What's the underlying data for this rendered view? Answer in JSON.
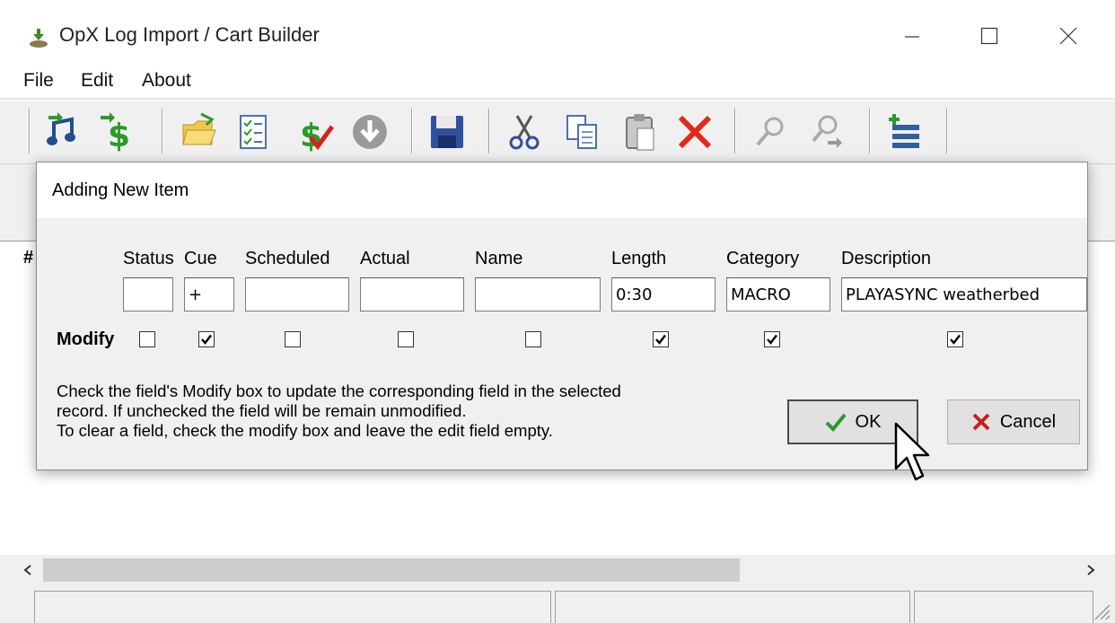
{
  "window": {
    "title": "OpX Log Import / Cart Builder"
  },
  "menu": {
    "items": [
      "File",
      "Edit",
      "About"
    ]
  },
  "toolbar": {
    "icons": [
      "import-music-icon",
      "import-cash-icon",
      "open-folder-icon",
      "checklist-icon",
      "cash-check-icon",
      "download-icon",
      "save-icon",
      "cut-icon",
      "copy-icon",
      "paste-icon",
      "delete-icon",
      "find-icon",
      "find-next-icon",
      "add-item-icon"
    ]
  },
  "list": {
    "column_hash": "#"
  },
  "dialog": {
    "title": "Adding New Item",
    "fields": [
      {
        "key": "status",
        "label": "Status",
        "value": ""
      },
      {
        "key": "cue",
        "label": "Cue",
        "value": "+"
      },
      {
        "key": "scheduled",
        "label": "Scheduled",
        "value": ""
      },
      {
        "key": "actual",
        "label": "Actual",
        "value": ""
      },
      {
        "key": "name",
        "label": "Name",
        "value": ""
      },
      {
        "key": "length",
        "label": "Length",
        "value": "0:30"
      },
      {
        "key": "category",
        "label": "Category",
        "value": "MACRO"
      },
      {
        "key": "description",
        "label": "Description",
        "value": "PLAYASYNC weatherbed"
      }
    ],
    "modify_label": "Modify",
    "modify_checked": [
      false,
      true,
      false,
      false,
      false,
      true,
      true,
      true
    ],
    "help_lines": [
      "Check the field's Modify box to update the corresponding field in the selected",
      "record. If unchecked the field will be remain unmodified.",
      "To clear a field, check the modify box and leave the edit field empty."
    ],
    "ok_label": "OK",
    "cancel_label": "Cancel"
  }
}
